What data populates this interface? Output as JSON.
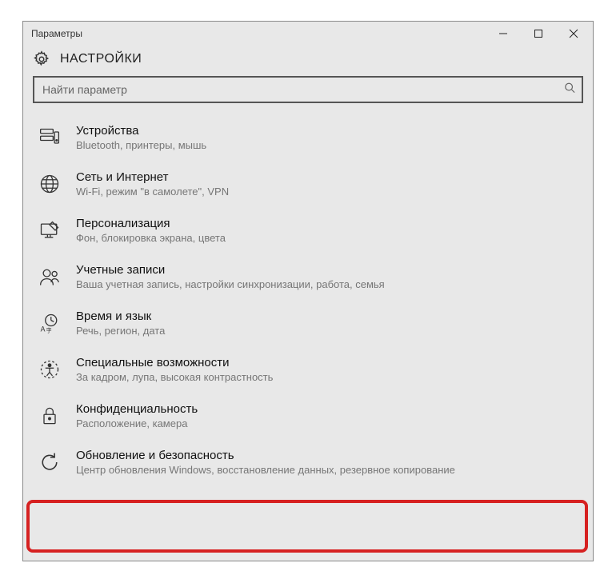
{
  "window_title": "Параметры",
  "page_title": "НАСТРОЙКИ",
  "search": {
    "placeholder": "Найти параметр"
  },
  "items": [
    {
      "title": "Устройства",
      "desc": "Bluetooth, принтеры, мышь"
    },
    {
      "title": "Сеть и Интернет",
      "desc": "Wi-Fi, режим \"в самолете\", VPN"
    },
    {
      "title": "Персонализация",
      "desc": "Фон, блокировка экрана, цвета"
    },
    {
      "title": "Учетные записи",
      "desc": "Ваша учетная запись, настройки синхронизации, работа, семья"
    },
    {
      "title": "Время и язык",
      "desc": "Речь, регион, дата"
    },
    {
      "title": "Специальные возможности",
      "desc": "За кадром, лупа, высокая контрастность"
    },
    {
      "title": "Конфиденциальность",
      "desc": "Расположение, камера"
    },
    {
      "title": "Обновление и безопасность",
      "desc": "Центр обновления Windows, восстановление данных, резервное копирование"
    }
  ]
}
